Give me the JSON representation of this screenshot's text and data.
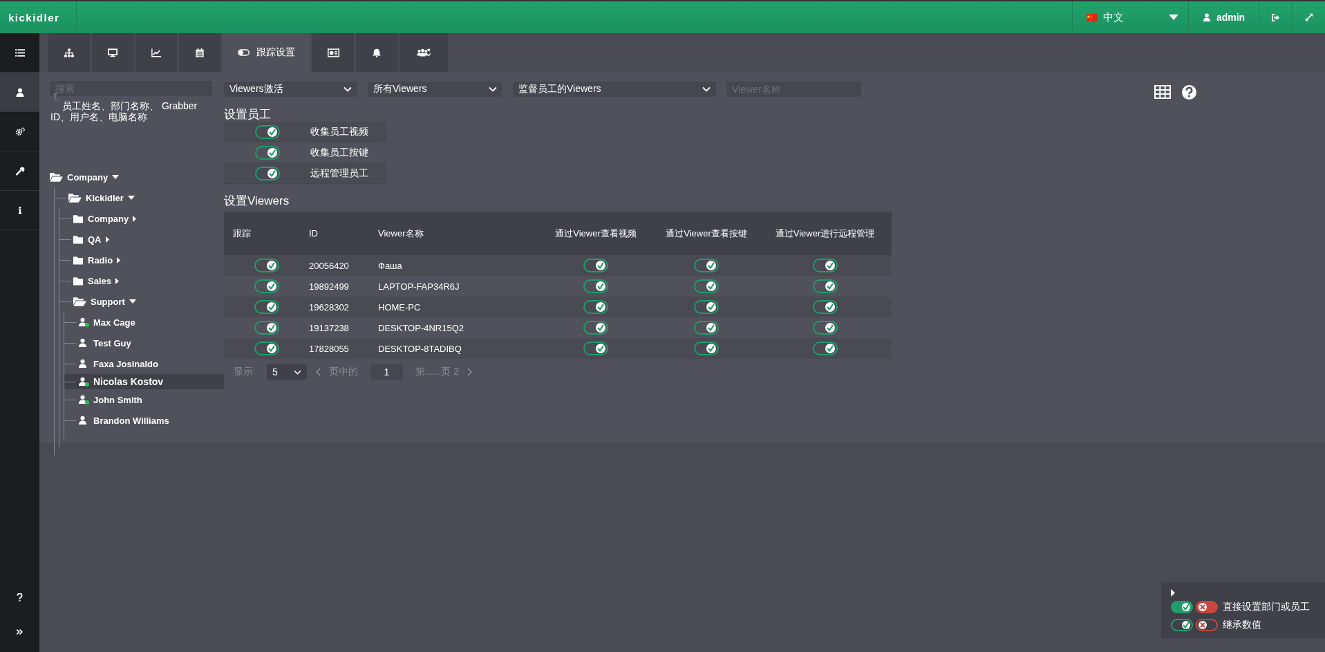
{
  "topbar": {
    "logo": "kickidler",
    "language": "中文",
    "user": "admin"
  },
  "sidebar": {
    "items": [
      {
        "kind": "list",
        "selected": false
      },
      {
        "kind": "user",
        "selected": true
      },
      {
        "kind": "gears",
        "selected": false
      },
      {
        "kind": "wrench",
        "selected": false
      },
      {
        "kind": "info",
        "selected": false
      }
    ],
    "bottom": [
      {
        "kind": "help"
      },
      {
        "kind": "expand"
      }
    ]
  },
  "tabs": [
    {
      "kind": "sitemap",
      "selected": false
    },
    {
      "kind": "monitor",
      "selected": false
    },
    {
      "kind": "chart",
      "selected": false
    },
    {
      "kind": "calendar",
      "selected": false
    },
    {
      "kind": "toggle",
      "label": "跟踪设置",
      "selected": true
    },
    {
      "kind": "card",
      "selected": false
    },
    {
      "kind": "bell",
      "selected": false
    },
    {
      "kind": "users",
      "selected": false
    }
  ],
  "search": {
    "placeholder": "搜索",
    "hint": "员工姓名、部门名称、 Grabber ID、用户名、电脑名称"
  },
  "tree": [
    {
      "label": "Company",
      "kind": "folder",
      "expanded": true,
      "children": [
        {
          "label": "Kickidler",
          "kind": "folder",
          "expanded": true,
          "children": [
            {
              "label": "Company",
              "kind": "folder",
              "expanded": false
            },
            {
              "label": "QA",
              "kind": "folder",
              "expanded": false
            },
            {
              "label": "Radio",
              "kind": "folder",
              "expanded": false
            },
            {
              "label": "Sales",
              "kind": "folder",
              "expanded": false
            },
            {
              "label": "Support",
              "kind": "folder",
              "expanded": true,
              "children": [
                {
                  "label": "Max Cage",
                  "kind": "user",
                  "online": true,
                  "selected": false
                },
                {
                  "label": "Test Guy",
                  "kind": "user",
                  "online": false,
                  "selected": false
                },
                {
                  "label": "Faxa Josinaldo",
                  "kind": "user",
                  "online": false,
                  "selected": false
                },
                {
                  "label": "Nicolas Kostov",
                  "kind": "user",
                  "online": true,
                  "selected": true
                },
                {
                  "label": "John Smith",
                  "kind": "user",
                  "online": true,
                  "selected": false
                },
                {
                  "label": "Brandon Williams",
                  "kind": "user",
                  "online": false,
                  "selected": false
                }
              ]
            }
          ]
        }
      ]
    }
  ],
  "filters": {
    "selects": [
      "Viewers激活",
      "所有Viewers",
      "监督员工的Viewers"
    ],
    "viewer_name": {
      "placeholder": "Viewer名称"
    }
  },
  "employee_settings": {
    "title": "设置员工",
    "items": [
      {
        "label": "收集员工视频",
        "on": true,
        "inherited": true
      },
      {
        "label": "收集员工按键",
        "on": true,
        "inherited": true
      },
      {
        "label": "远程管理员工",
        "on": true,
        "inherited": true
      }
    ]
  },
  "viewer_settings": {
    "title": "设置Viewers",
    "columns": [
      "跟踪",
      "ID",
      "Viewer名称",
      "通过Viewer查看视频",
      "通过Viewer查看按键",
      "通过Viewer进行远程管理"
    ],
    "rows": [
      {
        "id": "20056420",
        "name": "Фаша",
        "toggles": [
          {
            "on": true,
            "inherited": true
          },
          {
            "on": true,
            "inherited": true
          },
          {
            "on": true,
            "inherited": true
          },
          {
            "on": true,
            "inherited": true
          }
        ]
      },
      {
        "id": "19892499",
        "name": "LAPTOP-FAP34R6J",
        "toggles": [
          {
            "on": true,
            "inherited": true
          },
          {
            "on": true,
            "inherited": true
          },
          {
            "on": true,
            "inherited": true
          },
          {
            "on": true,
            "inherited": true
          }
        ]
      },
      {
        "id": "19628302",
        "name": "HOME-PC",
        "toggles": [
          {
            "on": true,
            "inherited": true
          },
          {
            "on": true,
            "inherited": true
          },
          {
            "on": true,
            "inherited": true
          },
          {
            "on": true,
            "inherited": true
          }
        ]
      },
      {
        "id": "19137238",
        "name": "DESKTOP-4NR15Q2",
        "toggles": [
          {
            "on": true,
            "inherited": true
          },
          {
            "on": true,
            "inherited": true
          },
          {
            "on": true,
            "inherited": true
          },
          {
            "on": true,
            "inherited": true
          }
        ]
      },
      {
        "id": "17828055",
        "name": "DESKTOP-8TADIBQ",
        "toggles": [
          {
            "on": true,
            "inherited": true
          },
          {
            "on": true,
            "inherited": true
          },
          {
            "on": true,
            "inherited": true
          },
          {
            "on": true,
            "inherited": true
          }
        ]
      }
    ]
  },
  "pagination": {
    "show_label": "显示",
    "page_size": "5",
    "page_label": "页中的",
    "page": "1",
    "total": "第......页 2"
  },
  "legend": {
    "expanded": false,
    "rows": [
      {
        "label": "直接设置部门或员工",
        "inherited": false
      },
      {
        "label": "继承数值",
        "inherited": true
      }
    ]
  }
}
